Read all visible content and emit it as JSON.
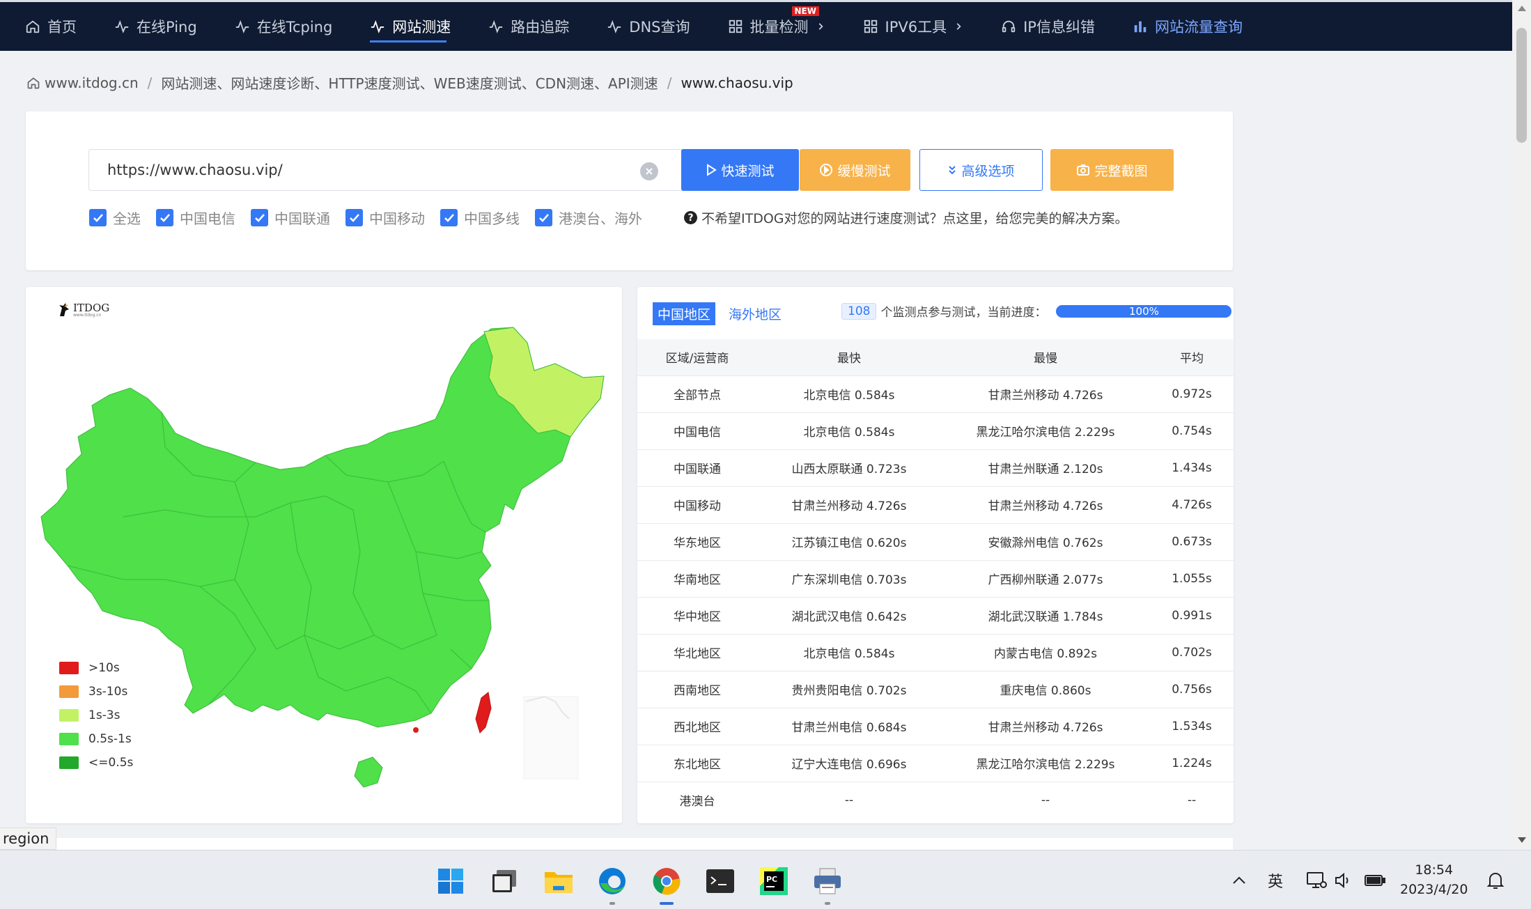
{
  "nav": {
    "items": [
      {
        "label": "首页",
        "icon": "home-icon"
      },
      {
        "label": "在线Ping",
        "icon": "pulse-icon"
      },
      {
        "label": "在线Tcping",
        "icon": "pulse-icon"
      },
      {
        "label": "网站测速",
        "icon": "pulse-icon"
      },
      {
        "label": "路由追踪",
        "icon": "pulse-icon"
      },
      {
        "label": "DNS查询",
        "icon": "pulse-icon"
      },
      {
        "label": "批量检测",
        "icon": "grid-icon",
        "badge": "NEW"
      },
      {
        "label": "IPV6工具",
        "icon": "grid-icon"
      },
      {
        "label": "IP信息纠错",
        "icon": "headset-icon"
      },
      {
        "label": "网站流量查询",
        "icon": "bar-chart-icon"
      }
    ]
  },
  "breadcrumb": {
    "home": "www.itdog.cn",
    "middle": "网站测速、网站速度诊断、HTTP速度测试、WEB速度测试、CDN测速、API测速",
    "current": "www.chaosu.vip"
  },
  "search": {
    "url": "https://www.chaosu.vip/",
    "buttons": {
      "quick": "快速测试",
      "slow": "缓慢测试",
      "advanced": "高级选项",
      "screenshot": "完整截图"
    },
    "checks": [
      "全选",
      "中国电信",
      "中国联通",
      "中国移动",
      "中国多线",
      "港澳台、海外"
    ],
    "hint": "不希望ITDOG对您的网站进行速度测试？点这里，给您完美的解决方案。"
  },
  "map": {
    "logo": "ITDOG",
    "logo_sub": "www.itdog.cn",
    "legend": [
      {
        "label": ">10s",
        "color": "#e01b1b"
      },
      {
        "label": "3s-10s",
        "color": "#f39a3a"
      },
      {
        "label": "1s-3s",
        "color": "#c2f264"
      },
      {
        "label": "0.5s-1s",
        "color": "#4fe04a"
      },
      {
        "label": "<=0.5s",
        "color": "#22a82a"
      }
    ]
  },
  "results": {
    "tabs": {
      "china": "中国地区",
      "overseas": "海外地区"
    },
    "node_count": "108",
    "progress_text": "个监测点参与测试，当前进度：",
    "progress": "100%",
    "headers": [
      "区域/运营商",
      "最快",
      "最慢",
      "平均"
    ],
    "rows": [
      [
        "全部节点",
        "北京电信 0.584s",
        "甘肃兰州移动 4.726s",
        "0.972s"
      ],
      [
        "中国电信",
        "北京电信 0.584s",
        "黑龙江哈尔滨电信 2.229s",
        "0.754s"
      ],
      [
        "中国联通",
        "山西太原联通 0.723s",
        "甘肃兰州联通 2.120s",
        "1.434s"
      ],
      [
        "中国移动",
        "甘肃兰州移动 4.726s",
        "甘肃兰州移动 4.726s",
        "4.726s"
      ],
      [
        "华东地区",
        "江苏镇江电信 0.620s",
        "安徽滁州电信 0.762s",
        "0.673s"
      ],
      [
        "华南地区",
        "广东深圳电信 0.703s",
        "广西柳州联通 2.077s",
        "1.055s"
      ],
      [
        "华中地区",
        "湖北武汉电信 0.642s",
        "湖北武汉联通 1.784s",
        "0.991s"
      ],
      [
        "华北地区",
        "北京电信 0.584s",
        "内蒙古电信 0.892s",
        "0.702s"
      ],
      [
        "西南地区",
        "贵州贵阳电信 0.702s",
        "重庆电信 0.860s",
        "0.756s"
      ],
      [
        "西北地区",
        "甘肃兰州电信 0.684s",
        "甘肃兰州移动 4.726s",
        "1.534s"
      ],
      [
        "东北地区",
        "辽宁大连电信 0.696s",
        "黑龙江哈尔滨电信 2.229s",
        "1.224s"
      ],
      [
        "港澳台",
        "--",
        "--",
        "--"
      ]
    ]
  },
  "status_tip": "region",
  "taskbar": {
    "ime": "英",
    "time": "18:54",
    "date": "2023/4/20"
  }
}
